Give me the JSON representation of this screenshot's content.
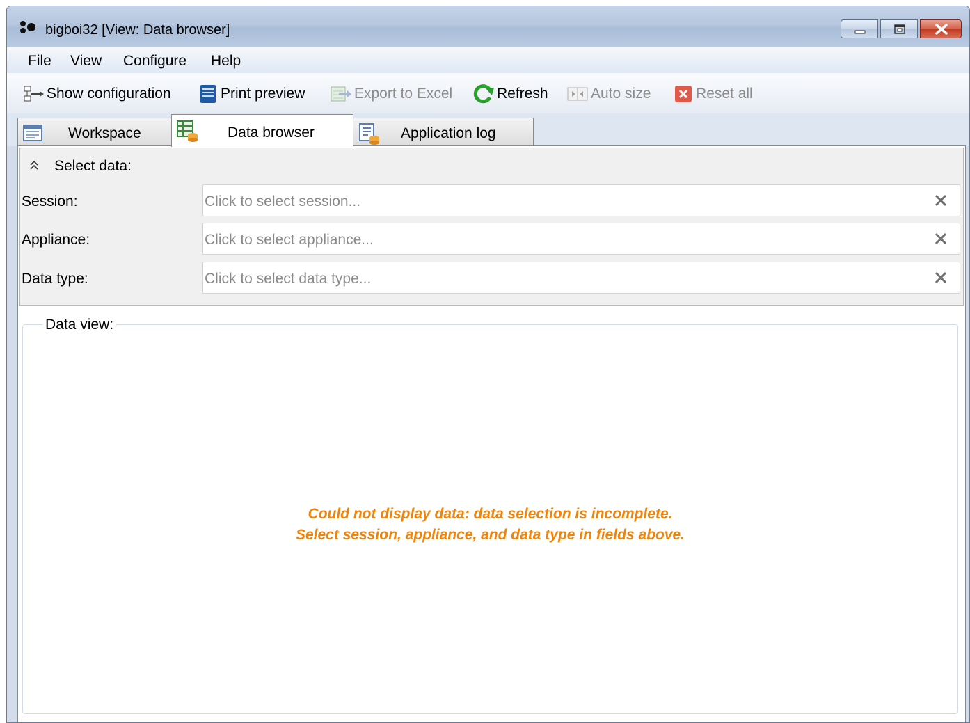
{
  "window": {
    "title": "bigboi32 [View: Data browser]",
    "controls": {
      "minimize": "minimize",
      "maximize": "maximize",
      "close": "close"
    }
  },
  "menu": {
    "items": [
      "File",
      "View",
      "Configure",
      "Help"
    ]
  },
  "toolbar": {
    "show_configuration": "Show configuration",
    "print_preview": "Print preview",
    "export_to_excel": "Export to Excel",
    "refresh": "Refresh",
    "auto_size": "Auto size",
    "reset_all": "Reset all",
    "disabled": [
      "Export to Excel",
      "Auto size",
      "Reset all"
    ]
  },
  "tabs": [
    {
      "label": "Workspace",
      "icon": "workspace-icon",
      "active": false
    },
    {
      "label": "Data browser",
      "icon": "data-browser-icon",
      "active": true
    },
    {
      "label": "Application log",
      "icon": "application-log-icon",
      "active": false
    }
  ],
  "select_data": {
    "title": "Select data:",
    "fields": [
      {
        "label": "Session:",
        "placeholder": "Click to select session..."
      },
      {
        "label": "Appliance:",
        "placeholder": "Click to select appliance..."
      },
      {
        "label": "Data type:",
        "placeholder": "Click to select data type..."
      }
    ]
  },
  "data_view": {
    "title": "Data view:",
    "message_line1": "Could not display data: data selection is incomplete.",
    "message_line2": "Select session, appliance, and data type in fields above."
  },
  "colors": {
    "message": "#f0830a",
    "titlebar": "#b6c7df",
    "close_button": "#c0391f",
    "refresh_icon": "#2aa12a",
    "reset_icon": "#e05a4a"
  }
}
